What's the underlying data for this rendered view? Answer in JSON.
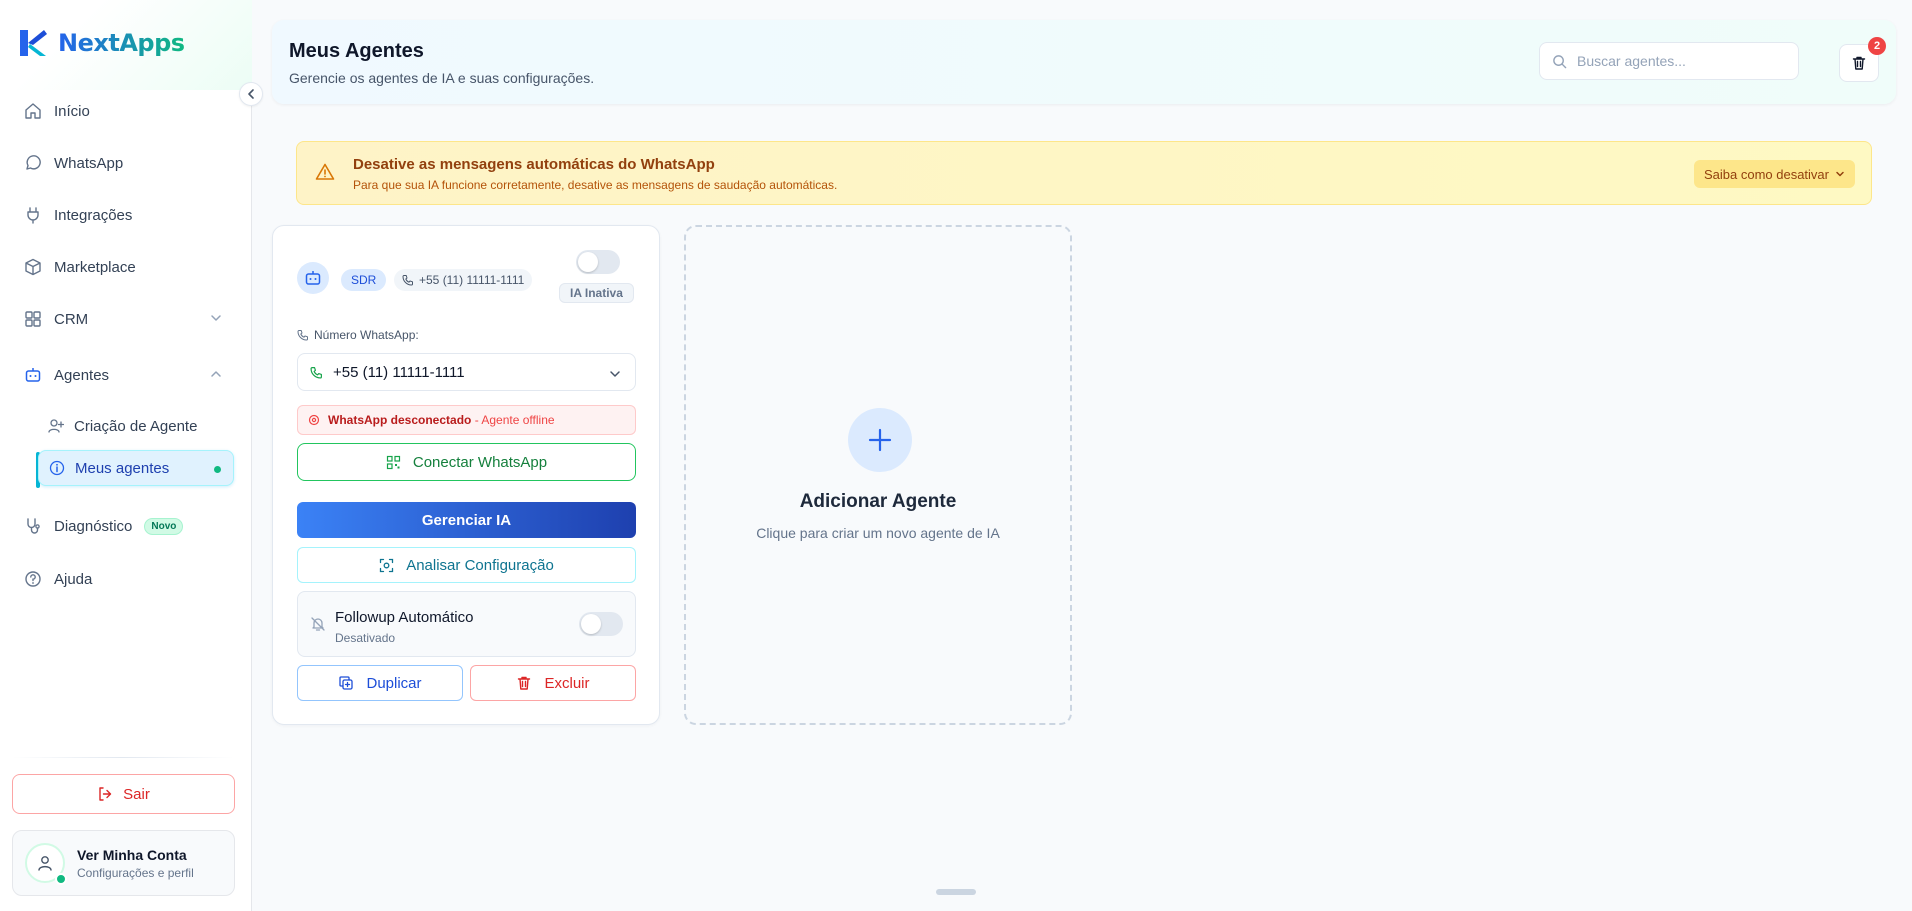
{
  "brand": {
    "name": "NextApps",
    "accent": "#2563eb",
    "accent2": "#10b981"
  },
  "sidebar": {
    "items": [
      {
        "label": "Início",
        "icon": "home-icon"
      },
      {
        "label": "WhatsApp",
        "icon": "whatsapp-icon"
      },
      {
        "label": "Integrações",
        "icon": "plug-icon"
      },
      {
        "label": "Marketplace",
        "icon": "package-icon"
      },
      {
        "label": "CRM",
        "icon": "grid-icon"
      },
      {
        "label": "Agentes",
        "icon": "bot-icon"
      },
      {
        "label": "Diagnóstico",
        "icon": "stethoscope-icon",
        "badge": "Novo"
      },
      {
        "label": "Ajuda",
        "icon": "help-icon"
      }
    ],
    "subitems": [
      {
        "label": "Criação de Agente",
        "icon": "user-plus-icon"
      },
      {
        "label": "Meus agentes",
        "icon": "info-icon"
      }
    ],
    "logout": "Sair",
    "account": {
      "title": "Ver Minha Conta",
      "subtitle": "Configurações e perfil"
    }
  },
  "header": {
    "title": "Meus Agentes",
    "subtitle": "Gerencie os agentes de IA e suas configurações.",
    "search_placeholder": "Buscar agentes...",
    "trash_count": "2"
  },
  "alert": {
    "title": "Desative as mensagens automáticas do WhatsApp",
    "message": "Para que sua IA funcione corretamente, desative as mensagens de saudação automáticas.",
    "action": "Saiba como desativar"
  },
  "agent": {
    "type_tag": "SDR",
    "phone_tag": "+55 (11) 11111-1111",
    "ia_status": "IA Inativa",
    "ia_enabled": false,
    "number_label": "Número WhatsApp:",
    "number_value": "+55 (11) 11111-1111",
    "connection_status": "WhatsApp desconectado",
    "connection_detail": "- Agente offline",
    "connect_button": "Conectar WhatsApp",
    "manage_button": "Gerenciar IA",
    "analyze_button": "Analisar Configuração",
    "followup_title": "Followup Automático",
    "followup_status": "Desativado",
    "followup_enabled": false,
    "duplicate_button": "Duplicar",
    "delete_button": "Excluir"
  },
  "add_agent": {
    "title": "Adicionar Agente",
    "subtitle": "Clique para criar um novo agente de IA"
  }
}
